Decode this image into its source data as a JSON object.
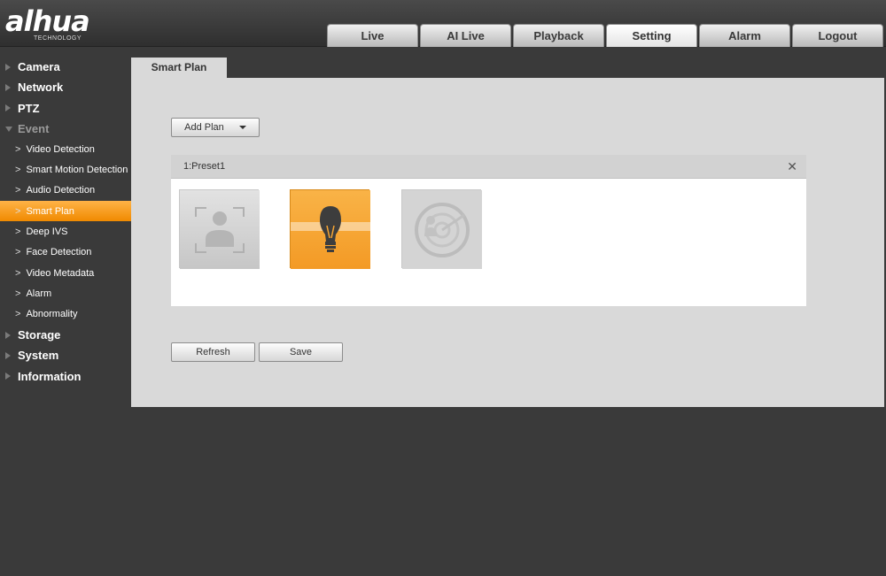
{
  "brand": {
    "logo": "alhua",
    "sub": "TECHNOLOGY"
  },
  "tabs": [
    "Live",
    "AI Live",
    "Playback",
    "Setting",
    "Alarm",
    "Logout"
  ],
  "active_tab": "Setting",
  "sidebar": {
    "items": [
      {
        "label": "Camera"
      },
      {
        "label": "Network"
      },
      {
        "label": "PTZ"
      },
      {
        "label": "Event"
      }
    ],
    "event_subitems": [
      {
        "label": "Video Detection"
      },
      {
        "label": "Smart Motion Detection"
      },
      {
        "label": "Audio Detection"
      },
      {
        "label": "Smart Plan"
      },
      {
        "label": "Deep IVS"
      },
      {
        "label": "Face Detection"
      },
      {
        "label": "Video Metadata"
      },
      {
        "label": "Alarm"
      },
      {
        "label": "Abnormality"
      }
    ],
    "bottom_items": [
      {
        "label": "Storage"
      },
      {
        "label": "System"
      },
      {
        "label": "Information"
      }
    ],
    "active_subitem": "Smart Plan"
  },
  "content": {
    "tab_label": "Smart Plan",
    "add_plan_label": "Add Plan",
    "preset_label": "1:Preset1",
    "cards": [
      {
        "icon": "face-detection-icon",
        "selected": false
      },
      {
        "icon": "lightbulb-icon",
        "selected": true
      },
      {
        "icon": "radar-icon",
        "selected": false
      }
    ],
    "refresh_label": "Refresh",
    "save_label": "Save"
  },
  "colors": {
    "accent": "#f7a533",
    "header": "#3a3a3a",
    "panel": "#d9d9d9"
  }
}
